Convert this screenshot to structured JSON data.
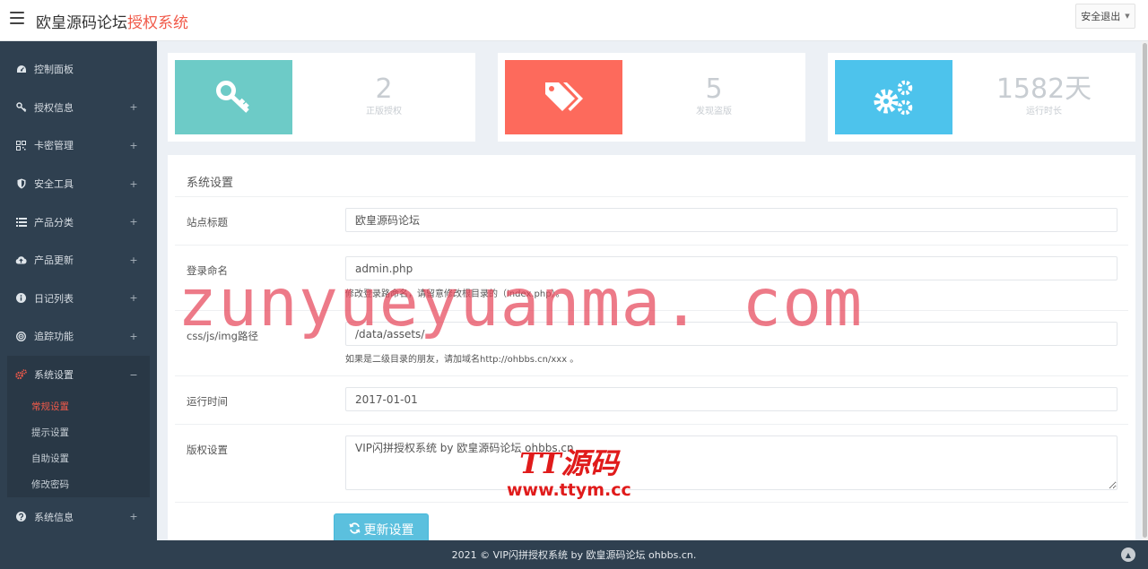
{
  "header": {
    "brand_prefix": "欧皇源码论坛",
    "brand_accent": "授权系统",
    "logout_label": "安全退出"
  },
  "sidebar": {
    "items": [
      {
        "label": "控制面板",
        "icon": "dashboard-icon"
      },
      {
        "label": "授权信息",
        "icon": "key-icon"
      },
      {
        "label": "卡密管理",
        "icon": "qrcode-icon"
      },
      {
        "label": "安全工具",
        "icon": "shield-icon"
      },
      {
        "label": "产品分类",
        "icon": "list-icon"
      },
      {
        "label": "产品更新",
        "icon": "cloud-upload-icon"
      },
      {
        "label": "日记列表",
        "icon": "info-icon"
      },
      {
        "label": "追踪功能",
        "icon": "target-icon"
      },
      {
        "label": "系统设置",
        "icon": "gears-icon"
      },
      {
        "label": "系统信息",
        "icon": "question-icon"
      }
    ],
    "expand_symbol": "+",
    "collapse_symbol": "−",
    "sub_items": [
      "常规设置",
      "提示设置",
      "自助设置",
      "修改密码"
    ]
  },
  "stats": [
    {
      "value": "2",
      "label": "正版授权",
      "color": "#6dcbc7",
      "icon": "key-icon"
    },
    {
      "value": "5",
      "label": "发现盗版",
      "color": "#fd6a5c",
      "icon": "tags-icon"
    },
    {
      "value": "1582天",
      "label": "运行时长",
      "color": "#4dc3ec",
      "icon": "gears-icon"
    }
  ],
  "settings": {
    "title": "系统设置",
    "fields": [
      {
        "label": "站点标题",
        "value": "欧皇源码论坛",
        "help": ""
      },
      {
        "label": "登录命名",
        "value": "admin.php",
        "help": "修改登录路命名，请留意修改根目录的（index.php）。"
      },
      {
        "label": "css/js/img路径",
        "value": "/data/assets/",
        "help": "如果是二级目录的朋友，请加域名http://ohbbs.cn/xxx 。"
      },
      {
        "label": "运行时间",
        "value": "2017-01-01",
        "help": ""
      },
      {
        "label": "版权设置",
        "value": "VIP闪拼授权系统 by 欧皇源码论坛 ohbbs.cn",
        "help": ""
      }
    ],
    "submit_label": "更新设置"
  },
  "footer": {
    "text": "2021 © VIP闪拼授权系统 by 欧皇源码论坛 ohbbs.cn."
  },
  "watermarks": {
    "main": "zunyueyuanma. com",
    "logo": "TT源码",
    "logo_url": "www.ttym.cc"
  }
}
